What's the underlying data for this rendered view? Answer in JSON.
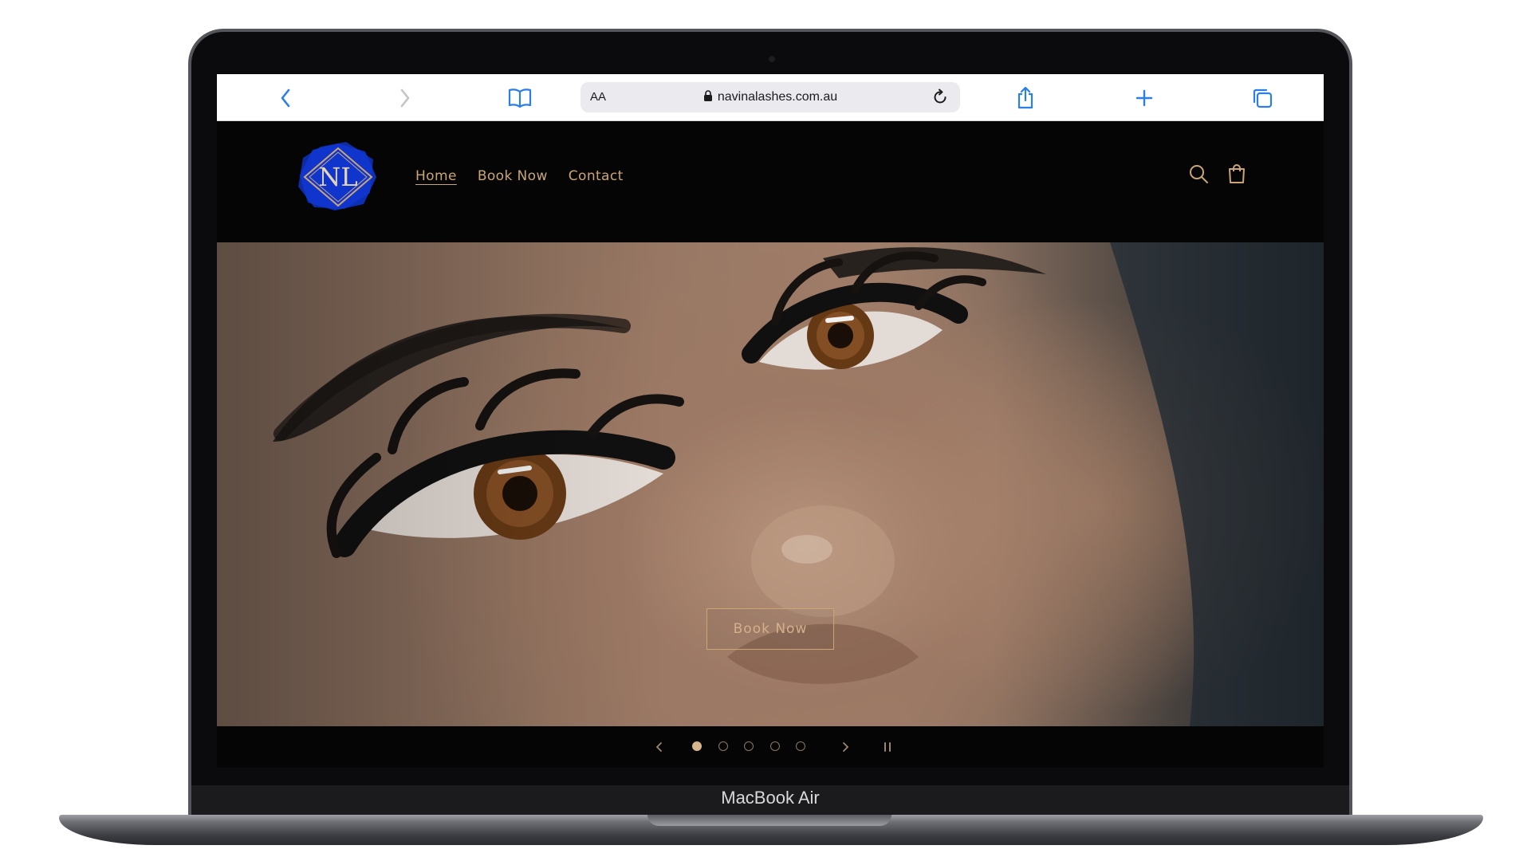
{
  "browser": {
    "text_size_label": "AA",
    "url": "navinalashes.com.au",
    "accent_color": "#2b7de9"
  },
  "site": {
    "logo_text": "NL",
    "nav": [
      {
        "label": "Home",
        "active": true
      },
      {
        "label": "Book Now",
        "active": false
      },
      {
        "label": "Contact",
        "active": false
      }
    ],
    "accent_color": "#c9a577",
    "background_color": "#050506"
  },
  "hero": {
    "cta_label": "Book Now",
    "slides_total": 5,
    "active_slide": 1
  },
  "device": {
    "label": "MacBook Air"
  }
}
